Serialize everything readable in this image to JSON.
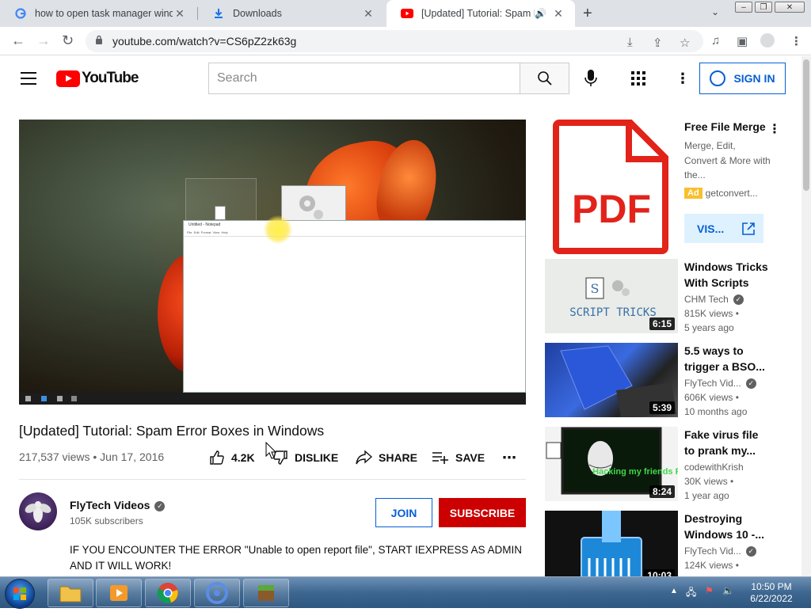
{
  "browser": {
    "tabs": [
      {
        "title": "how to open task manager windo",
        "active": false
      },
      {
        "title": "Downloads",
        "active": false
      },
      {
        "title": "[Updated] Tutorial: Spam Err",
        "active": true
      }
    ],
    "url": "youtube.com/watch?v=CS6pZ2zk63g"
  },
  "youtube": {
    "logo_text": "YouTube",
    "search_placeholder": "Search",
    "sign_in": "SIGN IN"
  },
  "video": {
    "title": "[Updated] Tutorial: Spam Error Boxes in Windows",
    "stats": "217,537 views • Jun 17, 2016",
    "likes": "4.2K",
    "dislike": "DISLIKE",
    "share": "SHARE",
    "save": "SAVE",
    "channel": "FlyTech Videos",
    "subscribers": "105K subscribers",
    "join": "JOIN",
    "subscribe": "SUBSCRIBE",
    "description": "IF YOU ENCOUNTER THE ERROR \"Unable to open report file\", START IEXPRESS AS ADMIN AND IT WILL WORK!"
  },
  "ad": {
    "title": "Free File Merge",
    "desc": "Merge, Edit, Convert & More with the...",
    "badge": "Ad",
    "domain": "getconvert...",
    "visit": "VIS...",
    "thumb_text": "PDF"
  },
  "recommendations": [
    {
      "title": "Windows Tricks With Scripts",
      "channel": "CHM Tech",
      "verified": true,
      "views": "815K views •",
      "age": "5 years ago",
      "duration": "6:15",
      "thumb_text": "SCRIPT TRICKS"
    },
    {
      "title": "5.5 ways to trigger a BSO...",
      "channel": "FlyTech Vid...",
      "verified": true,
      "views": "606K views •",
      "age": "10 months ago",
      "duration": "5:39"
    },
    {
      "title": "Fake virus file to prank my...",
      "channel": "codewithKrish",
      "verified": false,
      "views": "30K views •",
      "age": "1 year ago",
      "duration": "8:24",
      "thumb_text": "Hacking my friends PC"
    },
    {
      "title": "Destroying Windows 10 -...",
      "channel": "FlyTech Vid...",
      "verified": true,
      "views": "124K views •",
      "age": "",
      "duration": "10:03"
    }
  ],
  "taskbar": {
    "time": "10:50 PM",
    "date": "6/22/2022"
  },
  "colors": {
    "yt_red": "#ff0000",
    "subscribe_red": "#cc0000",
    "link_blue": "#065fd4",
    "ad_yellow": "#f9bf2c"
  }
}
